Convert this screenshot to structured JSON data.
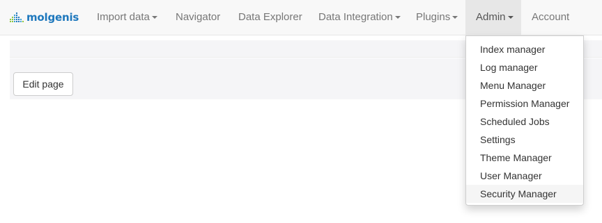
{
  "brand": {
    "name": "molgenis",
    "color": "#1e78bd",
    "icon": "bar-dots-logo-icon"
  },
  "navbar": {
    "items": [
      {
        "label": "Import data",
        "dropdown": true
      },
      {
        "label": "Navigator",
        "dropdown": false
      },
      {
        "label": "Data Explorer",
        "dropdown": false
      },
      {
        "label": "Data Integration",
        "dropdown": true
      },
      {
        "label": "Plugins",
        "dropdown": true
      },
      {
        "label": "Admin",
        "dropdown": true,
        "active": true
      },
      {
        "label": "Account",
        "dropdown": false
      }
    ]
  },
  "main": {
    "edit_button_label": "Edit page"
  },
  "admin_menu": {
    "items": [
      "Index manager",
      "Log manager",
      "Menu Manager",
      "Permission Manager",
      "Scheduled Jobs",
      "Settings",
      "Theme Manager",
      "User Manager",
      "Security Manager"
    ],
    "highlighted": "Security Manager"
  }
}
